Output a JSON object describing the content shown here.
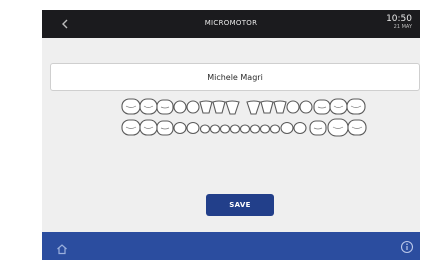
{
  "header": {
    "title": "MICROMOTOR",
    "time": "10:50",
    "date": "21 MAY"
  },
  "patient": {
    "name": "Michele Magri"
  },
  "actions": {
    "save_label": "SAVE"
  },
  "icons": {
    "back": "chevron-left-icon",
    "home": "home-icon",
    "info": "info-icon"
  },
  "colors": {
    "topbar": "#1b1b1e",
    "accent": "#223f8a",
    "bottombar": "#2b4d9f",
    "background": "#efefef"
  }
}
